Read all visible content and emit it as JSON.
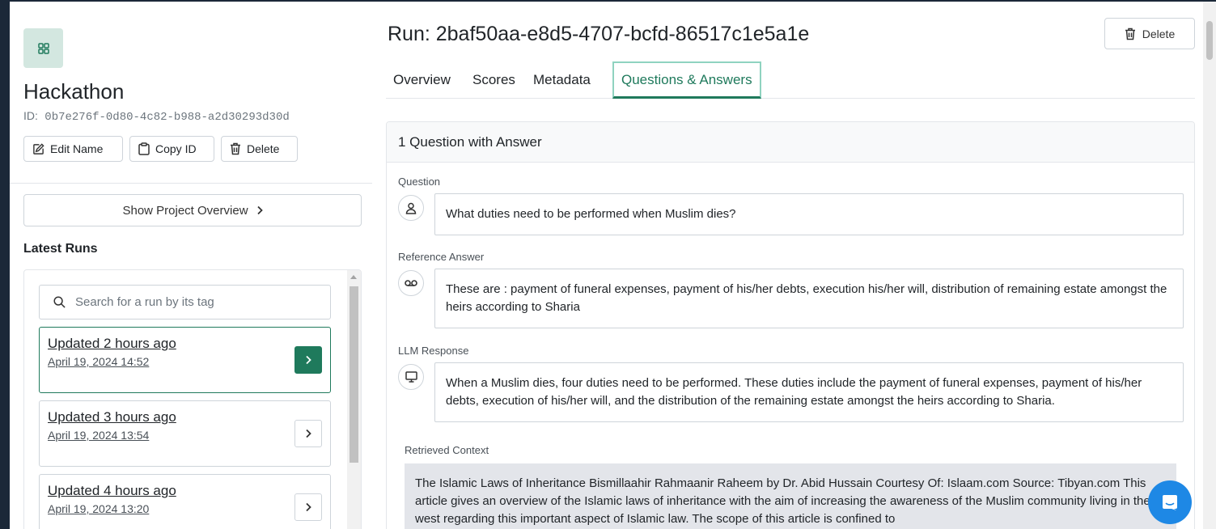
{
  "project": {
    "title": "Hackathon",
    "id_label": "ID:",
    "id_value": "0b7e276f-0d80-4c82-b988-a2d30293d30d",
    "edit_name": "Edit Name",
    "copy_id": "Copy ID",
    "delete": "Delete",
    "show_overview": "Show Project Overview"
  },
  "latest_runs": {
    "title": "Latest Runs",
    "search_placeholder": "Search for a run by its tag",
    "runs": [
      {
        "updated": "Updated 2 hours ago",
        "date": "April 19, 2024 14:52",
        "active": true
      },
      {
        "updated": "Updated 3 hours ago",
        "date": "April 19, 2024 13:54",
        "active": false
      },
      {
        "updated": "Updated 4 hours ago",
        "date": "April 19, 2024 13:20",
        "active": false
      }
    ]
  },
  "run": {
    "title": "Run: 2baf50aa-e8d5-4707-bcfd-86517c1e5a1e",
    "delete": "Delete"
  },
  "tabs": [
    "Overview",
    "Scores",
    "Metadata",
    "Questions & Answers"
  ],
  "qa": {
    "header": "1 Question with Answer",
    "question_label": "Question",
    "question": "What duties need to be performed when Muslim dies?",
    "reference_label": "Reference Answer",
    "reference": "These are : payment of funeral expenses, payment of his/her debts, execution his/her will, distribution of remaining estate amongst the heirs according to Sharia",
    "llm_label": "LLM Response",
    "llm": "When a Muslim dies, four duties need to be performed. These duties include the payment of funeral expenses, payment of his/her debts, execution of his/her will, and the distribution of the remaining estate amongst the heirs according to Sharia.",
    "context_label": "Retrieved Context",
    "context": "The Islamic Laws of Inheritance Bismillaahir Rahmaanir Raheem by Dr. Abid Hussain Courtesy Of: Islaam.com Source: Tibyan.com This article gives an overview of the Islamic laws of inheritance with the aim of increasing the awareness of the Muslim community living in the west regarding this important aspect of Islamic law. The scope of this article is confined to"
  },
  "colors": {
    "accent": "#1f7a5c",
    "accent_light": "#d3e7e0",
    "chat": "#1e88e5"
  }
}
